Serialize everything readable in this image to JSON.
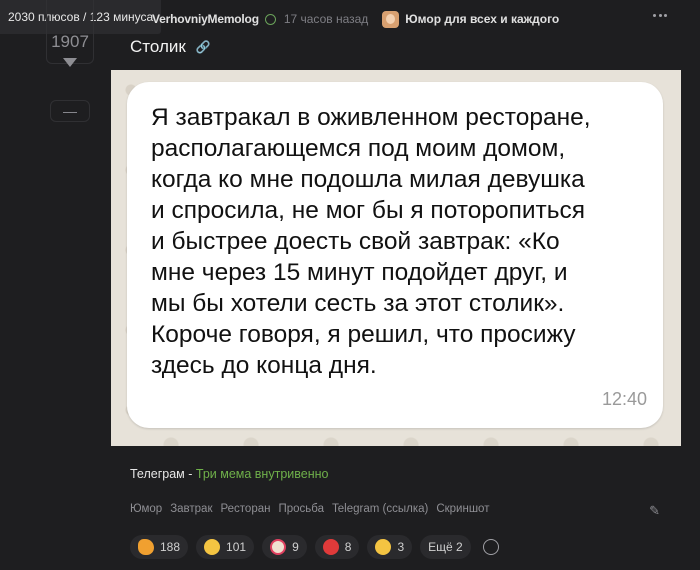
{
  "tooltip": "2030 плюсов / 123 минуса",
  "vote": {
    "count": "1907",
    "minus": "—"
  },
  "header": {
    "author": "VerhovniyMemolog",
    "time": "17 часов назад",
    "community": "Юмор для всех и каждого"
  },
  "post": {
    "title": "Столик",
    "message": "Я завтракал в оживленном ресторане,\nрасполагающемся под моим домом,\nкогда ко мне подошла милая девушка\nи спросила, не мог бы я поторопиться\nи быстрее доесть свой завтрак: «Ко\nмне через 15 минут подойдет друг, и\nмы бы хотели сесть за этот столик».\nКороче говоря, я решил, что просижу\nздесь до конца дня.",
    "message_time": "12:40"
  },
  "source": {
    "name": "Телеграм",
    "separator": " - ",
    "link": "Три мема внутривенно"
  },
  "tags": [
    "Юмор",
    "Завтрак",
    "Ресторан",
    "Просьба",
    "Telegram (ссылка)",
    "Скриншот"
  ],
  "reactions": [
    {
      "icon": "clap-icon",
      "count": "188"
    },
    {
      "icon": "smile-icon",
      "count": "101"
    },
    {
      "icon": "clown-icon",
      "count": "9"
    },
    {
      "icon": "angry-icon",
      "count": "8"
    },
    {
      "icon": "sweat-smile-icon",
      "count": "3"
    }
  ],
  "more_reactions": "Ещё 2",
  "colors": {
    "accent_green": "#6fb04a",
    "background": "#1e1e20"
  }
}
